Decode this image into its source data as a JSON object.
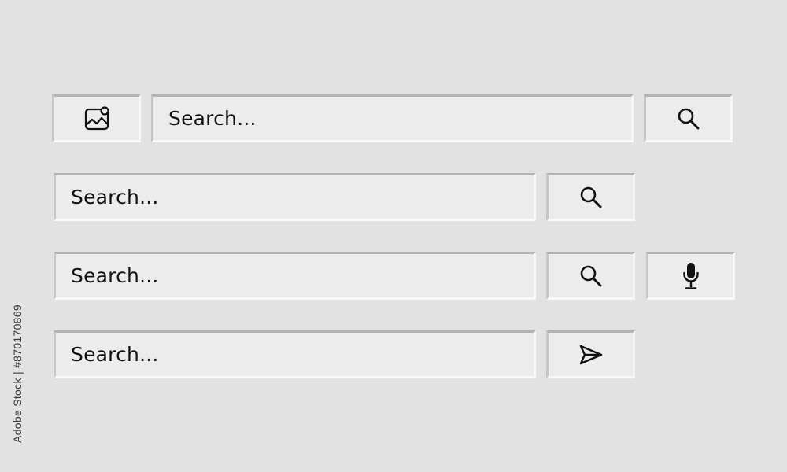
{
  "search_bars": [
    {
      "placeholder": "Search...",
      "leading_icon": "image-icon",
      "trailing_icons": [
        "search-icon"
      ]
    },
    {
      "placeholder": "Search...",
      "trailing_icons": [
        "search-icon"
      ]
    },
    {
      "placeholder": "Search...",
      "trailing_icons": [
        "search-icon",
        "microphone-icon"
      ]
    },
    {
      "placeholder": "Search...",
      "trailing_icons": [
        "send-icon"
      ]
    }
  ],
  "watermark": {
    "text": "Adobe Stock",
    "side_id": "Adobe Stock | #870170869"
  },
  "colors": {
    "background": "#e2e2e2",
    "field": "#ececec",
    "icon": "#111111"
  }
}
